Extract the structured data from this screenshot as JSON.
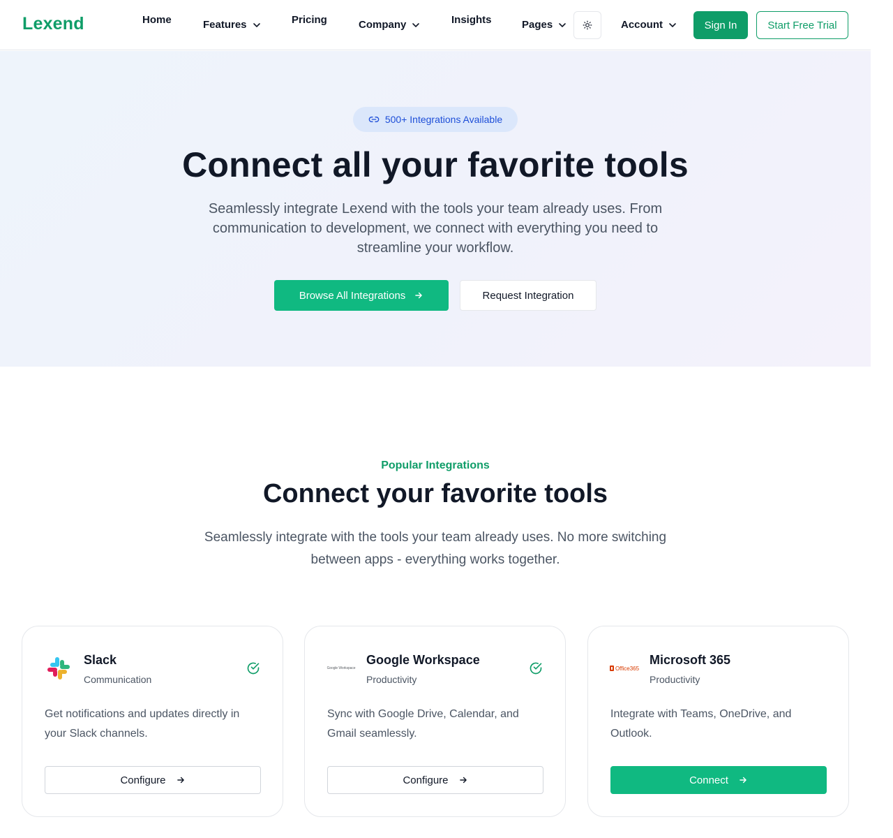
{
  "nav": {
    "logo": "Lexend",
    "items": [
      {
        "label": "Home"
      },
      {
        "label": "Features"
      },
      {
        "label": "Pricing"
      },
      {
        "label": "Company"
      },
      {
        "label": "Insights"
      },
      {
        "label": "Pages"
      }
    ],
    "account_label": "Account",
    "signin_label": "Sign In",
    "trial_label": "Start Free Trial",
    "theme_icon": "sun-icon",
    "accent_color": "#0f9d68"
  },
  "hero": {
    "badge": "500+ Integrations Available",
    "badge_icon": "link-icon",
    "title": "Connect all your favorite tools",
    "subtitle": "Seamlessly integrate Lexend with the tools your team already uses. From communication to development, we connect with everything you need to streamline your workflow.",
    "primary_button": "Browse All Integrations",
    "secondary_button": "Request Integration",
    "button_color": "#10b981"
  },
  "popular": {
    "eyebrow": "Popular Integrations",
    "title": "Connect your favorite tools",
    "subtitle": "Seamlessly integrate with the tools your team already uses. No more switching between apps - everything works together.",
    "cards": [
      {
        "name": "Slack",
        "category": "Communication",
        "description": "Get notifications and updates directly in your Slack channels.",
        "button": "Configure",
        "connected": true,
        "logo_icon": "slack-logo-icon"
      },
      {
        "name": "Google Workspace",
        "category": "Productivity",
        "description": "Sync with Google Drive, Calendar, and Gmail seamlessly.",
        "button": "Configure",
        "connected": true,
        "logo_icon": "google-workspace-logo-icon",
        "logo_text": "Google Workspace"
      },
      {
        "name": "Microsoft 365",
        "category": "Productivity",
        "description": "Integrate with Teams, OneDrive, and Outlook.",
        "button": "Connect",
        "connected": false,
        "logo_icon": "office365-logo-icon",
        "logo_text": "Office365"
      }
    ]
  }
}
